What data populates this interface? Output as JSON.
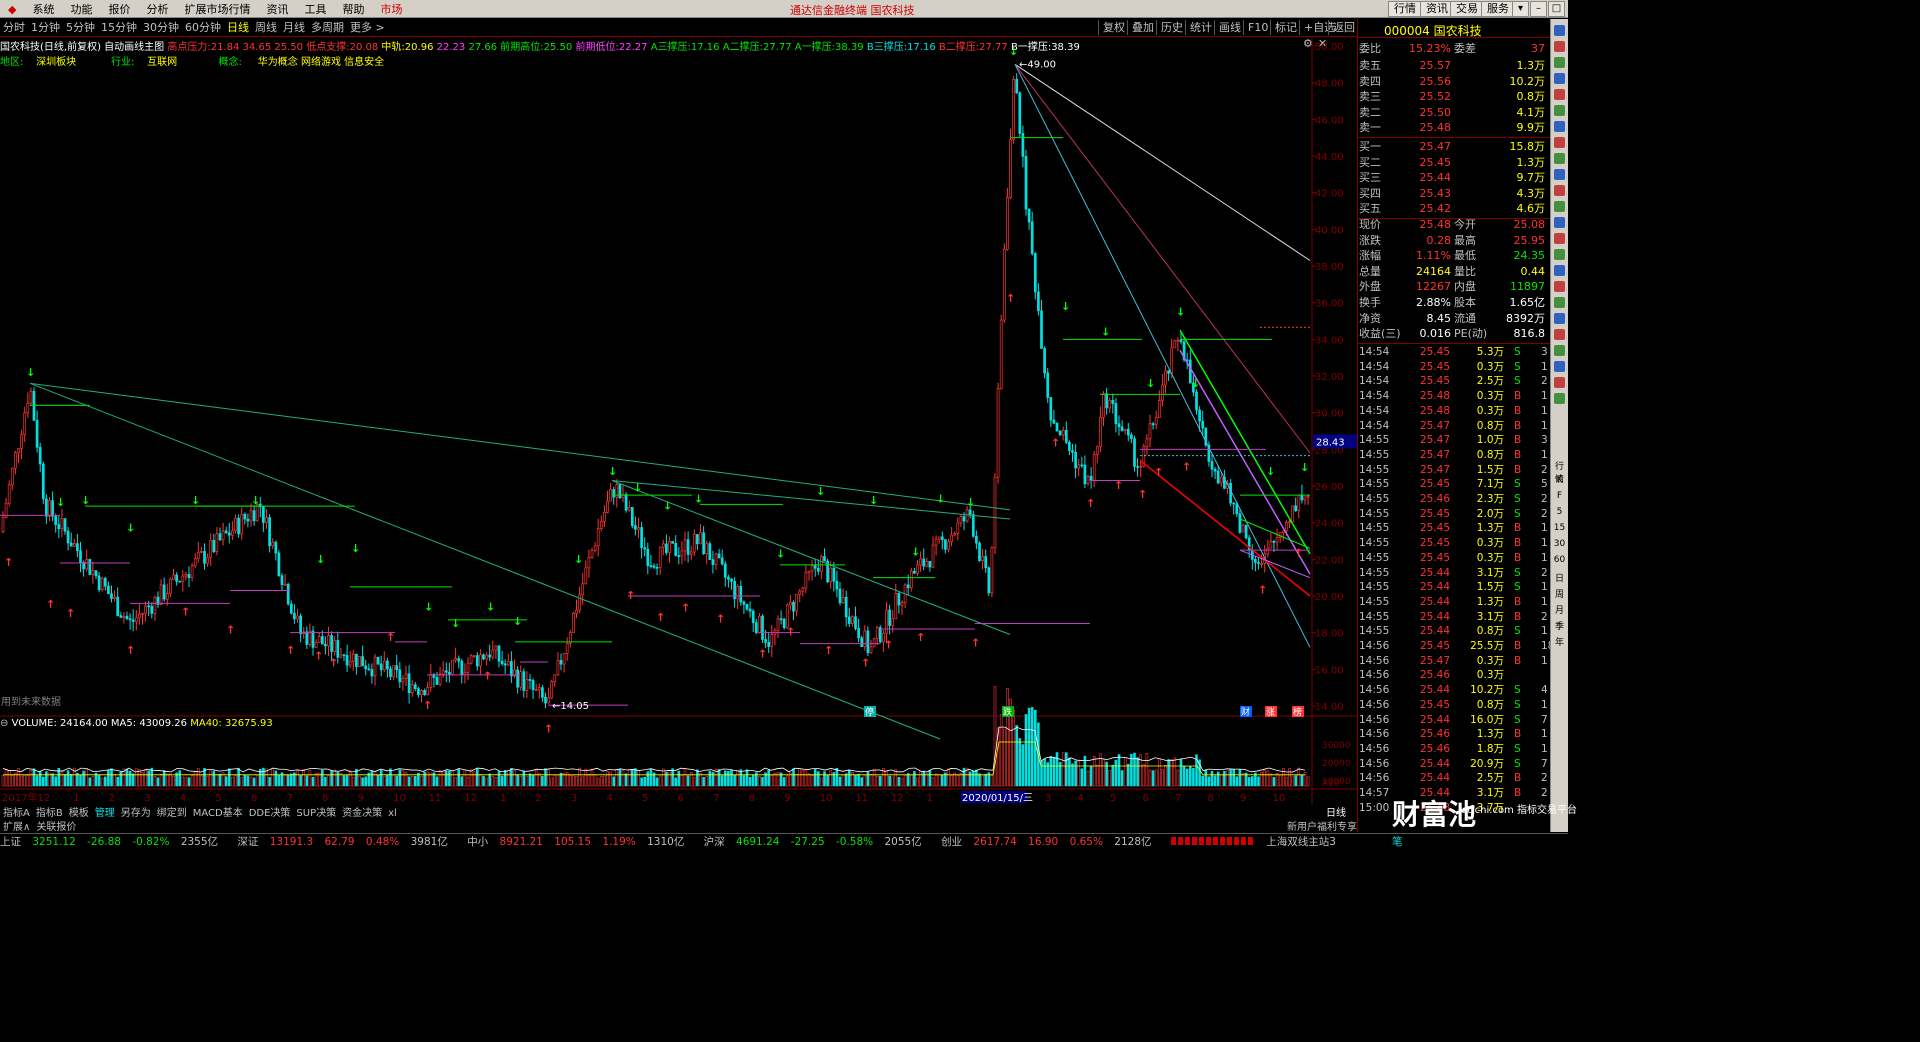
{
  "menu": {
    "items": [
      "系统",
      "功能",
      "报价",
      "分析",
      "扩展市场行情",
      "资讯",
      "工具",
      "帮助"
    ],
    "market": "市场",
    "title": "通达信金融终端  国农科技"
  },
  "topright": {
    "quote": "行情",
    "news": "资讯",
    "trade": "交易",
    "service": "服务"
  },
  "periods": [
    "分时",
    "1分钟",
    "5分钟",
    "15分钟",
    "30分钟",
    "60分钟",
    "日线",
    "周线",
    "月线",
    "多周期",
    "更多 >"
  ],
  "active_period": "日线",
  "right_tools": [
    "复权",
    "叠加",
    "历史",
    "统计",
    "画线",
    "F10",
    "标记",
    "+自选",
    "返回"
  ],
  "info1": {
    "name": "国农科技(日线,前复权)",
    "chart": "自动画线主图",
    "k1": "高点压力:",
    "v1": "21.84",
    "v1b": "34.65",
    "v1c": "25.50",
    "k2": "低点支撑:",
    "v2": "20.08",
    "k3": "中轨:",
    "v3": "20.96",
    "v3b": "22.23",
    "v3c": "27.66",
    "k4": "前期高位:",
    "v4": "25.50",
    "k5": "前期低位:",
    "v5": "22.27",
    "k6": "A三撑压:",
    "v6": "17.16",
    "k7": "A二撑压:",
    "v7": "27.77",
    "k8": "A一撑压:",
    "v8": "38.39",
    "k9": "B三撑压:",
    "v9": "17.16",
    "k10": "B二撑压:",
    "v10": "27.77",
    "k11": "B一撑压:",
    "v11": "38.39"
  },
  "info2": {
    "k1": "地区:",
    "v1": "深圳板块",
    "k2": "行业:",
    "v2": "互联网",
    "k3": "概念:",
    "v3": "华为概念 网络游戏 信息安全"
  },
  "chart_data": {
    "type": "candlestick",
    "ylim": [
      14,
      50
    ],
    "yticks": [
      "50.00",
      "48.00",
      "46.00",
      "44.00",
      "42.00",
      "40.00",
      "38.00",
      "36.00",
      "34.00",
      "32.00",
      "30.00",
      "28.00",
      "26.00",
      "24.00",
      "22.00",
      "20.00",
      "18.00",
      "16.00",
      "14.00"
    ],
    "high_label": "49.00",
    "low_label": "14.05",
    "current_label": "28.43",
    "future_note": "用到未来数据",
    "xticks": [
      "2017年",
      "12",
      "1",
      "2",
      "3",
      "4",
      "5",
      "6",
      "7",
      "8",
      "9",
      "10",
      "11",
      "12",
      "1",
      "2",
      "3",
      "4",
      "5",
      "6",
      "7",
      "8",
      "9",
      "10",
      "11",
      "12",
      "1",
      "2020/01/15/三",
      "3",
      "4",
      "5",
      "6",
      "7",
      "8",
      "9",
      "10"
    ],
    "event_marks": [
      "停",
      "跌",
      "财",
      "涨",
      "榜"
    ],
    "volume": {
      "label": "VOLUME:",
      "value": "24164.00",
      "ma5_label": "MA5:",
      "ma5": "43009.26",
      "ma40_label": "MA40:",
      "ma40": "32675.93",
      "yticks": [
        "30000",
        "20000",
        "10000"
      ],
      "unit": "X10"
    }
  },
  "tabs": [
    "指标A",
    "指标B",
    "模板",
    "管理",
    "另存为",
    "绑定到",
    "MACD基本",
    "DDE决策",
    "SUP决策",
    "资金决策",
    "xl"
  ],
  "tabs_active": "管理",
  "tabs2": [
    "扩展∧",
    "关联报价"
  ],
  "period_tag": "日线",
  "stock": {
    "code": "000004",
    "name": "国农科技"
  },
  "orderbook": {
    "weibi_k": "委比",
    "weibi": "15.23%",
    "weicha_k": "委差",
    "weicha": "37",
    "asks": [
      {
        "k": "卖五",
        "p": "25.57",
        "v": "1.3万"
      },
      {
        "k": "卖四",
        "p": "25.56",
        "v": "10.2万"
      },
      {
        "k": "卖三",
        "p": "25.52",
        "v": "0.8万"
      },
      {
        "k": "卖二",
        "p": "25.50",
        "v": "4.1万"
      },
      {
        "k": "卖一",
        "p": "25.48",
        "v": "9.9万"
      }
    ],
    "bids": [
      {
        "k": "买一",
        "p": "25.47",
        "v": "15.8万"
      },
      {
        "k": "买二",
        "p": "25.45",
        "v": "1.3万"
      },
      {
        "k": "买三",
        "p": "25.44",
        "v": "9.7万"
      },
      {
        "k": "买四",
        "p": "25.43",
        "v": "4.3万"
      },
      {
        "k": "买五",
        "p": "25.42",
        "v": "4.6万"
      }
    ]
  },
  "quote": [
    {
      "k1": "现价",
      "v1": "25.48",
      "k2": "今开",
      "v2": "25.08"
    },
    {
      "k1": "涨跌",
      "v1": "0.28",
      "k2": "最高",
      "v2": "25.95"
    },
    {
      "k1": "涨幅",
      "v1": "1.11%",
      "k2": "最低",
      "v2": "24.35"
    },
    {
      "k1": "总量",
      "v1": "24164",
      "k2": "量比",
      "v2": "0.44"
    },
    {
      "k1": "外盘",
      "v1": "12267",
      "k2": "内盘",
      "v2": "11897"
    },
    {
      "k1": "换手",
      "v1": "2.88%",
      "k2": "股本",
      "v2": "1.65亿"
    },
    {
      "k1": "净资",
      "v1": "8.45",
      "k2": "流通",
      "v2": "8392万"
    },
    {
      "k1": "收益(三)",
      "v1": "0.016",
      "k2": "PE(动)",
      "v2": "816.8"
    }
  ],
  "ticks": [
    [
      "14:54",
      "25.45",
      "5.3万",
      "S",
      "3"
    ],
    [
      "14:54",
      "25.45",
      "0.3万",
      "S",
      "1"
    ],
    [
      "14:54",
      "25.45",
      "2.5万",
      "S",
      "2"
    ],
    [
      "14:54",
      "25.48",
      "0.3万",
      "B",
      "1"
    ],
    [
      "14:54",
      "25.48",
      "0.3万",
      "B",
      "1"
    ],
    [
      "14:54",
      "25.47",
      "0.8万",
      "B",
      "1"
    ],
    [
      "14:55",
      "25.47",
      "1.0万",
      "B",
      "3"
    ],
    [
      "14:55",
      "25.47",
      "0.8万",
      "B",
      "1"
    ],
    [
      "14:55",
      "25.47",
      "1.5万",
      "B",
      "2"
    ],
    [
      "14:55",
      "25.45",
      "7.1万",
      "S",
      "5"
    ],
    [
      "14:55",
      "25.46",
      "2.3万",
      "S",
      "2"
    ],
    [
      "14:55",
      "25.45",
      "2.0万",
      "S",
      "2"
    ],
    [
      "14:55",
      "25.45",
      "1.3万",
      "B",
      "1"
    ],
    [
      "14:55",
      "25.45",
      "0.3万",
      "B",
      "1"
    ],
    [
      "14:55",
      "25.45",
      "0.3万",
      "B",
      "1"
    ],
    [
      "14:55",
      "25.44",
      "3.1万",
      "S",
      "2"
    ],
    [
      "14:55",
      "25.44",
      "1.5万",
      "S",
      "1"
    ],
    [
      "14:55",
      "25.44",
      "1.3万",
      "B",
      "1"
    ],
    [
      "14:55",
      "25.44",
      "3.1万",
      "B",
      "2"
    ],
    [
      "14:55",
      "25.44",
      "0.8万",
      "S",
      "1"
    ],
    [
      "14:56",
      "25.45",
      "25.5万",
      "B",
      "18"
    ],
    [
      "14:56",
      "25.47",
      "0.3万",
      "B",
      "1"
    ],
    [
      "14:56",
      "25.46",
      "0.3万",
      "",
      ""
    ],
    [
      "14:56",
      "25.44",
      "10.2万",
      "S",
      "4"
    ],
    [
      "14:56",
      "25.45",
      "0.8万",
      "S",
      "1"
    ],
    [
      "14:56",
      "25.44",
      "16.0万",
      "S",
      "7"
    ],
    [
      "14:56",
      "25.46",
      "1.3万",
      "B",
      "1"
    ],
    [
      "14:56",
      "25.46",
      "1.8万",
      "S",
      "1"
    ],
    [
      "14:56",
      "25.44",
      "20.9万",
      "S",
      "7"
    ],
    [
      "14:56",
      "25.44",
      "2.5万",
      "B",
      "2"
    ],
    [
      "14:57",
      "25.44",
      "3.1万",
      "B",
      "2"
    ],
    [
      "15:00",
      "25.48",
      "3.7万",
      "",
      ""
    ]
  ],
  "rstrip": [
    "行情",
    "K",
    "F",
    "5",
    "15",
    "30",
    "60",
    "日",
    "周",
    "月",
    "季",
    "年"
  ],
  "status": {
    "sh_k": "上证",
    "sh": "3251.12",
    "sh_c": "-26.88",
    "sh_p": "-0.82%",
    "sh_v": "2355亿",
    "sz_k": "深证",
    "sz": "13191.3",
    "sz_c": "62.79",
    "sz_p": "0.48%",
    "sz_v": "3981亿",
    "zx_k": "中小",
    "zx": "8921.21",
    "zx_c": "105.15",
    "zx_p": "1.19%",
    "zx_v": "1310亿",
    "hs_k": "沪深",
    "hs": "4691.24",
    "hs_c": "-27.25",
    "hs_p": "-0.58%",
    "hs_v": "2055亿",
    "cy_k": "创业",
    "cy": "2617.74",
    "cy_c": "16.90",
    "cy_p": "0.65%",
    "cy_v": "2128亿",
    "server": "上海双线主站3",
    "promo": "新用户福利专享",
    "pen": "笔"
  },
  "watermark": {
    "big": "财富池",
    "small": "stfchi.com 指标交易平台"
  }
}
